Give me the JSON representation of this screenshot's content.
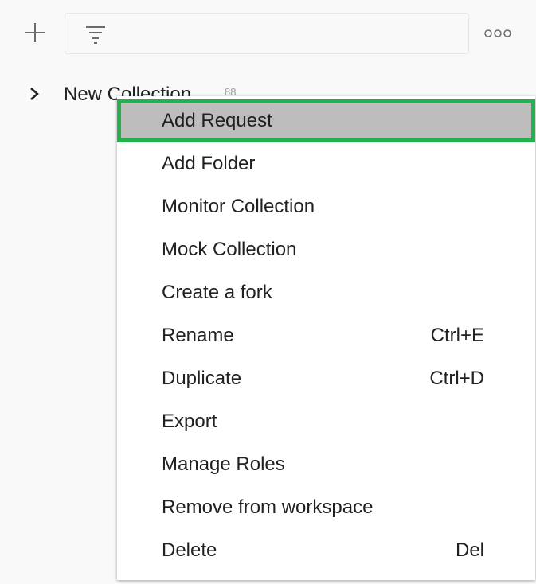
{
  "toolbar": {
    "add_icon": "plus-icon",
    "filter_icon": "filter-icon",
    "filter_value": "",
    "filter_placeholder": "",
    "more_icon": "more-horizontal-icon"
  },
  "collection": {
    "expand_icon": "chevron-right-icon",
    "name": "New Collection",
    "meta": "88"
  },
  "context_menu": {
    "items": [
      {
        "label": "Add Request",
        "shortcut": ""
      },
      {
        "label": "Add Folder",
        "shortcut": ""
      },
      {
        "label": "Monitor Collection",
        "shortcut": ""
      },
      {
        "label": "Mock Collection",
        "shortcut": ""
      },
      {
        "label": "Create a fork",
        "shortcut": ""
      },
      {
        "label": "Rename",
        "shortcut": "Ctrl+E"
      },
      {
        "label": "Duplicate",
        "shortcut": "Ctrl+D"
      },
      {
        "label": "Export",
        "shortcut": ""
      },
      {
        "label": "Manage Roles",
        "shortcut": ""
      },
      {
        "label": "Remove from workspace",
        "shortcut": ""
      },
      {
        "label": "Delete",
        "shortcut": "Del"
      }
    ],
    "active_index": 0
  },
  "colors": {
    "background": "#f9f9f9",
    "menu_background": "#ffffff",
    "highlight_fill": "#bdbdbd",
    "highlight_border": "#22b14c",
    "text": "#212121",
    "icon": "#6b6b6b"
  }
}
